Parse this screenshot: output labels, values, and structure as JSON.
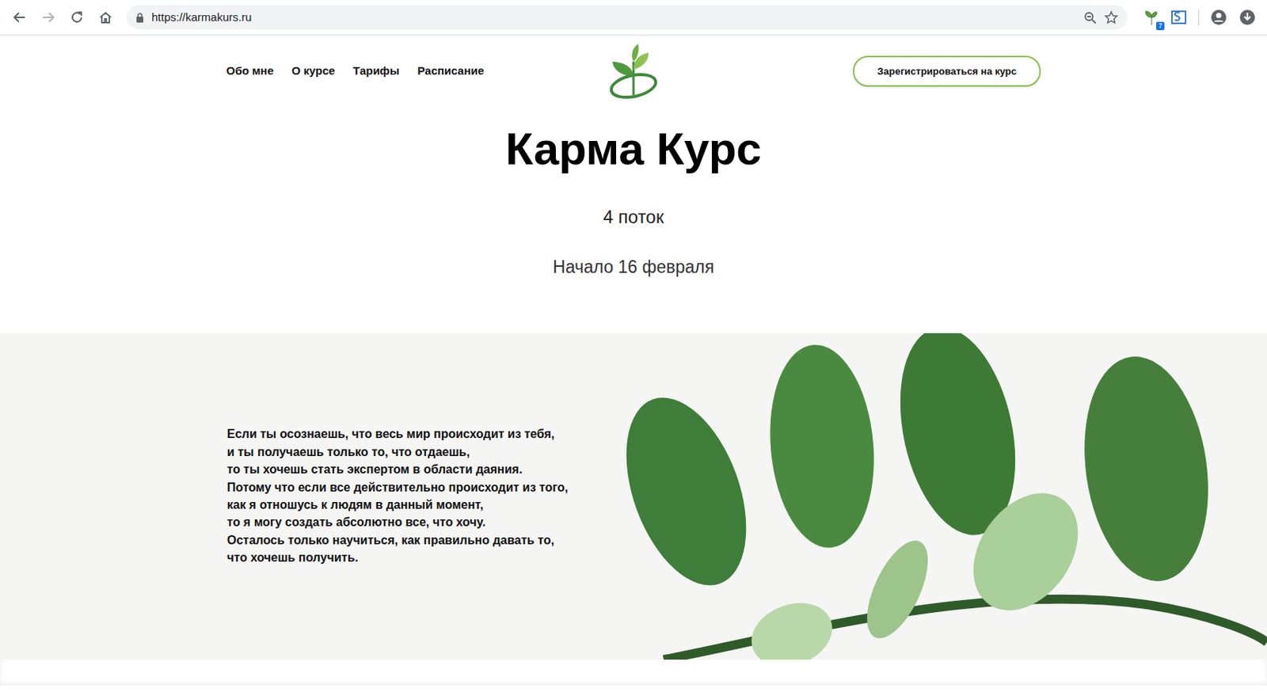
{
  "browser": {
    "url": "https://karmakurs.ru",
    "extension_badge": "7"
  },
  "nav": {
    "links": [
      "Обо мне",
      "О курсе",
      "Тарифы",
      "Расписание"
    ],
    "register": "Зарегистрироваться на курс"
  },
  "hero": {
    "title": "Карма Курс",
    "stream": "4 поток",
    "start": "Начало 16 февраля"
  },
  "intro": {
    "lines": [
      "Если ты осознаешь, что весь мир происходит из тебя,",
      "и ты получаешь только то, что отдаешь,",
      "то ты хочешь стать экспертом в области даяния.",
      "Потому что если все действительно происходит из того,",
      "как я отношусь к людям в данный момент,",
      "то я могу создать абсолютно все, что хочу.",
      "Осталось только научиться, как правильно давать то,",
      "что хочешь получить."
    ]
  }
}
